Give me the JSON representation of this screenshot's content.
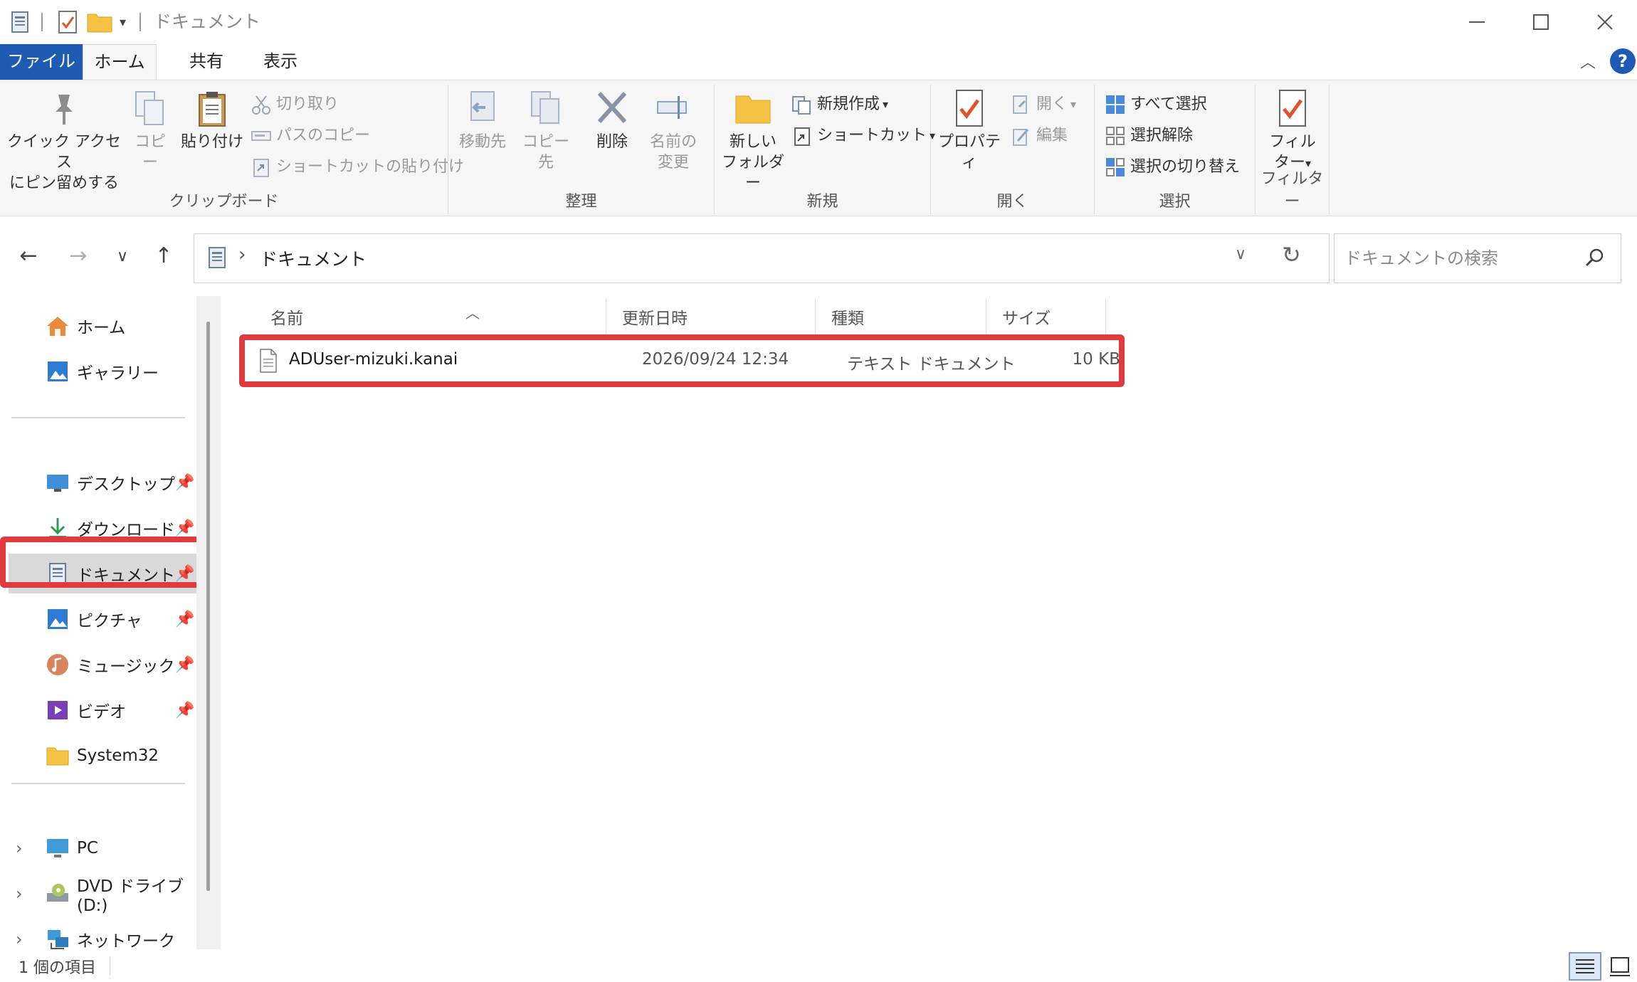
{
  "window": {
    "title": "ドキュメント",
    "controls": [
      "minimize",
      "maximize",
      "close"
    ]
  },
  "tabs": {
    "file": "ファイル",
    "home": "ホーム",
    "share": "共有",
    "view": "表示"
  },
  "ribbon": {
    "clipboard": {
      "label": "クリップボード",
      "pin_line1": "クイック アクセス",
      "pin_line2": "にピン留めする",
      "copy": "コピー",
      "paste": "貼り付け",
      "cut": "切り取り",
      "copy_path": "パスのコピー",
      "paste_shortcut": "ショートカットの貼り付け"
    },
    "organize": {
      "label": "整理",
      "move_to": "移動先",
      "copy_to": "コピー先",
      "delete": "削除",
      "rename_line1": "名前の",
      "rename_line2": "変更"
    },
    "new": {
      "label": "新規",
      "new_folder_line1": "新しい",
      "new_folder_line2": "フォルダー",
      "new_item": "新規作成",
      "shortcut": "ショートカット"
    },
    "open": {
      "label": "開く",
      "properties": "プロパティ",
      "open": "開く",
      "edit": "編集"
    },
    "select": {
      "label": "選択",
      "select_all": "すべて選択",
      "select_none": "選択解除",
      "invert": "選択の切り替え"
    },
    "filter": {
      "label": "フィルター",
      "btn_line1": "フィル",
      "btn_line2": "ター"
    }
  },
  "address": {
    "crumb": "ドキュメント",
    "search_placeholder": "ドキュメントの検索"
  },
  "sidebar": {
    "top": [
      {
        "label": "ホーム",
        "icon": "home-icon"
      },
      {
        "label": "ギャラリー",
        "icon": "gallery-icon"
      }
    ],
    "pinned": [
      {
        "label": "デスクトップ",
        "icon": "desktop-icon"
      },
      {
        "label": "ダウンロード",
        "icon": "download-icon"
      },
      {
        "label": "ドキュメント",
        "icon": "documents-icon",
        "selected": true
      },
      {
        "label": "ピクチャ",
        "icon": "pictures-icon"
      },
      {
        "label": "ミュージック",
        "icon": "music-icon"
      },
      {
        "label": "ビデオ",
        "icon": "videos-icon"
      },
      {
        "label": "System32",
        "icon": "folder-icon"
      }
    ],
    "bottom": [
      {
        "label": "PC",
        "icon": "pc-icon"
      },
      {
        "label": "DVD ドライブ (D:)",
        "icon": "dvd-icon"
      },
      {
        "label": "ネットワーク",
        "icon": "network-icon"
      }
    ]
  },
  "columns": {
    "name": "名前",
    "modified": "更新日時",
    "type": "種類",
    "size": "サイズ"
  },
  "files": [
    {
      "name": "ADUser-mizuki.kanai",
      "modified": "2026/09/24 12:34",
      "type": "テキスト ドキュメント",
      "size": "10 KB"
    }
  ],
  "status": {
    "count": "1 個の項目"
  },
  "colors": {
    "accent": "#1f5bb3",
    "highlight": "#e0393e",
    "folder": "#f5c244",
    "check": "#e0532e"
  }
}
